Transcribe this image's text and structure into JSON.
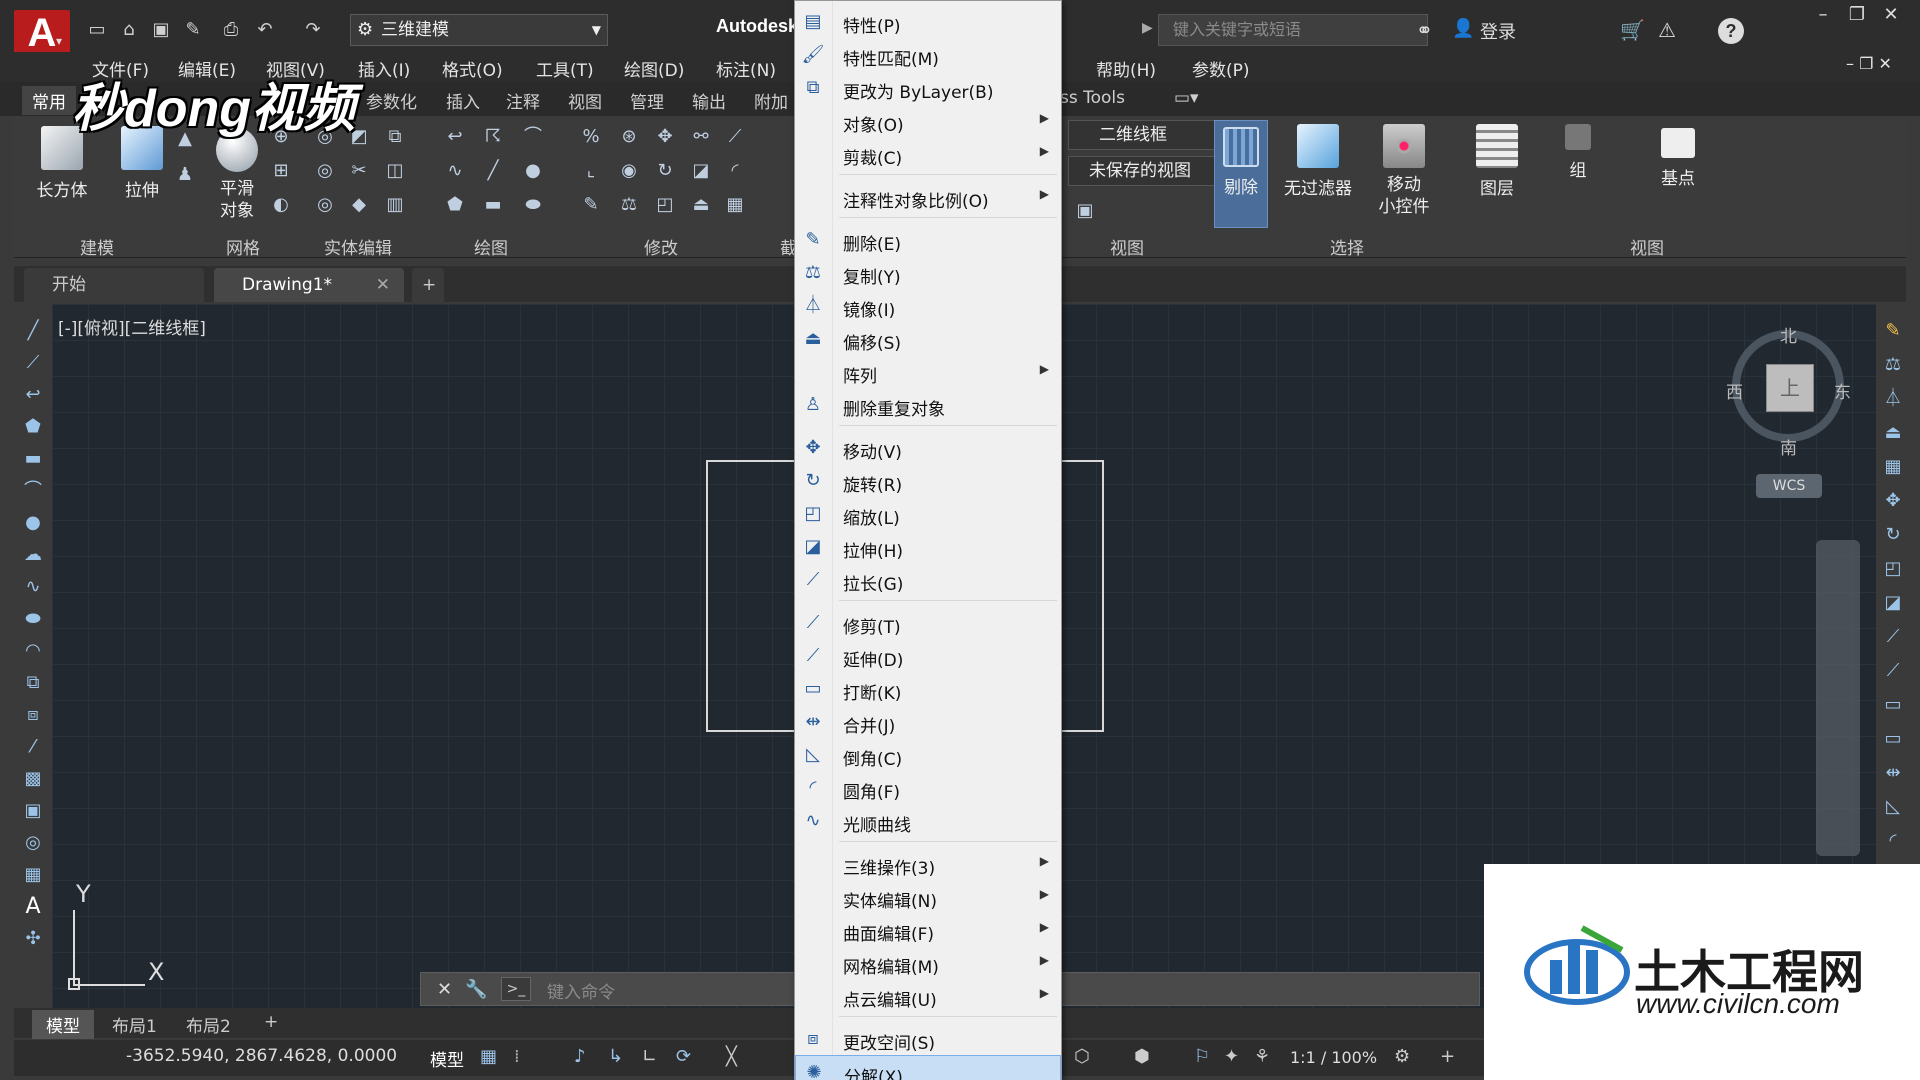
{
  "titlebar": {
    "workspace": "三维建模",
    "app_title": "Autodesk",
    "search_placeholder": "键入关键字或短语",
    "login": "登录"
  },
  "menubar": [
    "文件(F)",
    "编辑(E)",
    "视图(V)",
    "插入(I)",
    "格式(O)",
    "工具(T)",
    "绘图(D)",
    "标注(N)",
    "帮助(H)",
    "参数(P)"
  ],
  "ribbon_tabs": [
    "常用",
    "参数化",
    "插入",
    "注释",
    "视图",
    "管理",
    "输出",
    "附加",
    "ss Tools"
  ],
  "ribbon": {
    "buttons": {
      "box": "长方体",
      "extrude": "拉伸",
      "smooth": "平滑\n对象",
      "delete": "剔除",
      "nofilter": "无过滤器",
      "gizmo": "移动\n小控件",
      "layers": "图层",
      "group": "组",
      "basepoint": "基点"
    },
    "combos": {
      "visual_style": "二维线框",
      "view": "未保存的视图"
    },
    "panels": [
      "建模",
      "网格",
      "实体编辑",
      "绘图",
      "修改",
      "截",
      "视图",
      "选择",
      "视图"
    ]
  },
  "doc_tabs": [
    "开始",
    "Drawing1*"
  ],
  "viewport_label": "[-][俯视][二维线框]",
  "viewcube": {
    "north": "北",
    "south": "南",
    "east": "东",
    "west": "西",
    "face": "上",
    "wcs": "WCS"
  },
  "ucs": {
    "x": "X",
    "y": "Y"
  },
  "command_placeholder": "键入命令",
  "layout_tabs": [
    "模型",
    "布局1",
    "布局2"
  ],
  "status": {
    "coords": "-3652.5940, 2867.4628, 0.0000",
    "model": "模型",
    "scale": "1:1 / 100%"
  },
  "context_menu": [
    {
      "label": "特性(P)",
      "icon": "properties-icon",
      "submenu": false
    },
    {
      "label": "特性匹配(M)",
      "icon": "match-properties-icon",
      "submenu": false
    },
    {
      "label": "更改为 ByLayer(B)",
      "icon": "bylayer-icon",
      "submenu": false
    },
    {
      "label": "对象(O)",
      "icon": "",
      "submenu": true
    },
    {
      "label": "剪裁(C)",
      "icon": "",
      "submenu": true
    },
    {
      "sep": true
    },
    {
      "label": "注释性对象比例(O)",
      "icon": "",
      "submenu": true
    },
    {
      "sep": true
    },
    {
      "label": "删除(E)",
      "icon": "erase-icon",
      "submenu": false
    },
    {
      "label": "复制(Y)",
      "icon": "copy-icon",
      "submenu": false
    },
    {
      "label": "镜像(I)",
      "icon": "mirror-icon",
      "submenu": false
    },
    {
      "label": "偏移(S)",
      "icon": "offset-icon",
      "submenu": false
    },
    {
      "label": "阵列",
      "icon": "",
      "submenu": true
    },
    {
      "label": "删除重复对象",
      "icon": "overkill-icon",
      "submenu": false
    },
    {
      "sep": true
    },
    {
      "label": "移动(V)",
      "icon": "move-icon",
      "submenu": false
    },
    {
      "label": "旋转(R)",
      "icon": "rotate-icon",
      "submenu": false
    },
    {
      "label": "缩放(L)",
      "icon": "scale-icon",
      "submenu": false
    },
    {
      "label": "拉伸(H)",
      "icon": "stretch-icon",
      "submenu": false
    },
    {
      "label": "拉长(G)",
      "icon": "lengthen-icon",
      "submenu": false
    },
    {
      "sep": true
    },
    {
      "label": "修剪(T)",
      "icon": "trim-icon",
      "submenu": false
    },
    {
      "label": "延伸(D)",
      "icon": "extend-icon",
      "submenu": false
    },
    {
      "label": "打断(K)",
      "icon": "break-icon",
      "submenu": false
    },
    {
      "label": "合并(J)",
      "icon": "join-icon",
      "submenu": false
    },
    {
      "label": "倒角(C)",
      "icon": "chamfer-icon",
      "submenu": false
    },
    {
      "label": "圆角(F)",
      "icon": "fillet-icon",
      "submenu": false
    },
    {
      "label": "光顺曲线",
      "icon": "blend-curves-icon",
      "submenu": false
    },
    {
      "sep": true
    },
    {
      "label": "三维操作(3)",
      "icon": "",
      "submenu": true
    },
    {
      "label": "实体编辑(N)",
      "icon": "",
      "submenu": true
    },
    {
      "label": "曲面编辑(F)",
      "icon": "",
      "submenu": true
    },
    {
      "label": "网格编辑(M)",
      "icon": "",
      "submenu": true
    },
    {
      "label": "点云编辑(U)",
      "icon": "",
      "submenu": true
    },
    {
      "sep": true
    },
    {
      "label": "更改空间(S)",
      "icon": "change-space-icon",
      "submenu": false
    },
    {
      "label": "分解(X)",
      "icon": "explode-icon",
      "submenu": false,
      "highlighted": true
    }
  ],
  "watermarks": {
    "top_left": "秒dong视频",
    "bottom_right_cn": "土木工程网",
    "bottom_right_url": "www.civilcn.com"
  }
}
